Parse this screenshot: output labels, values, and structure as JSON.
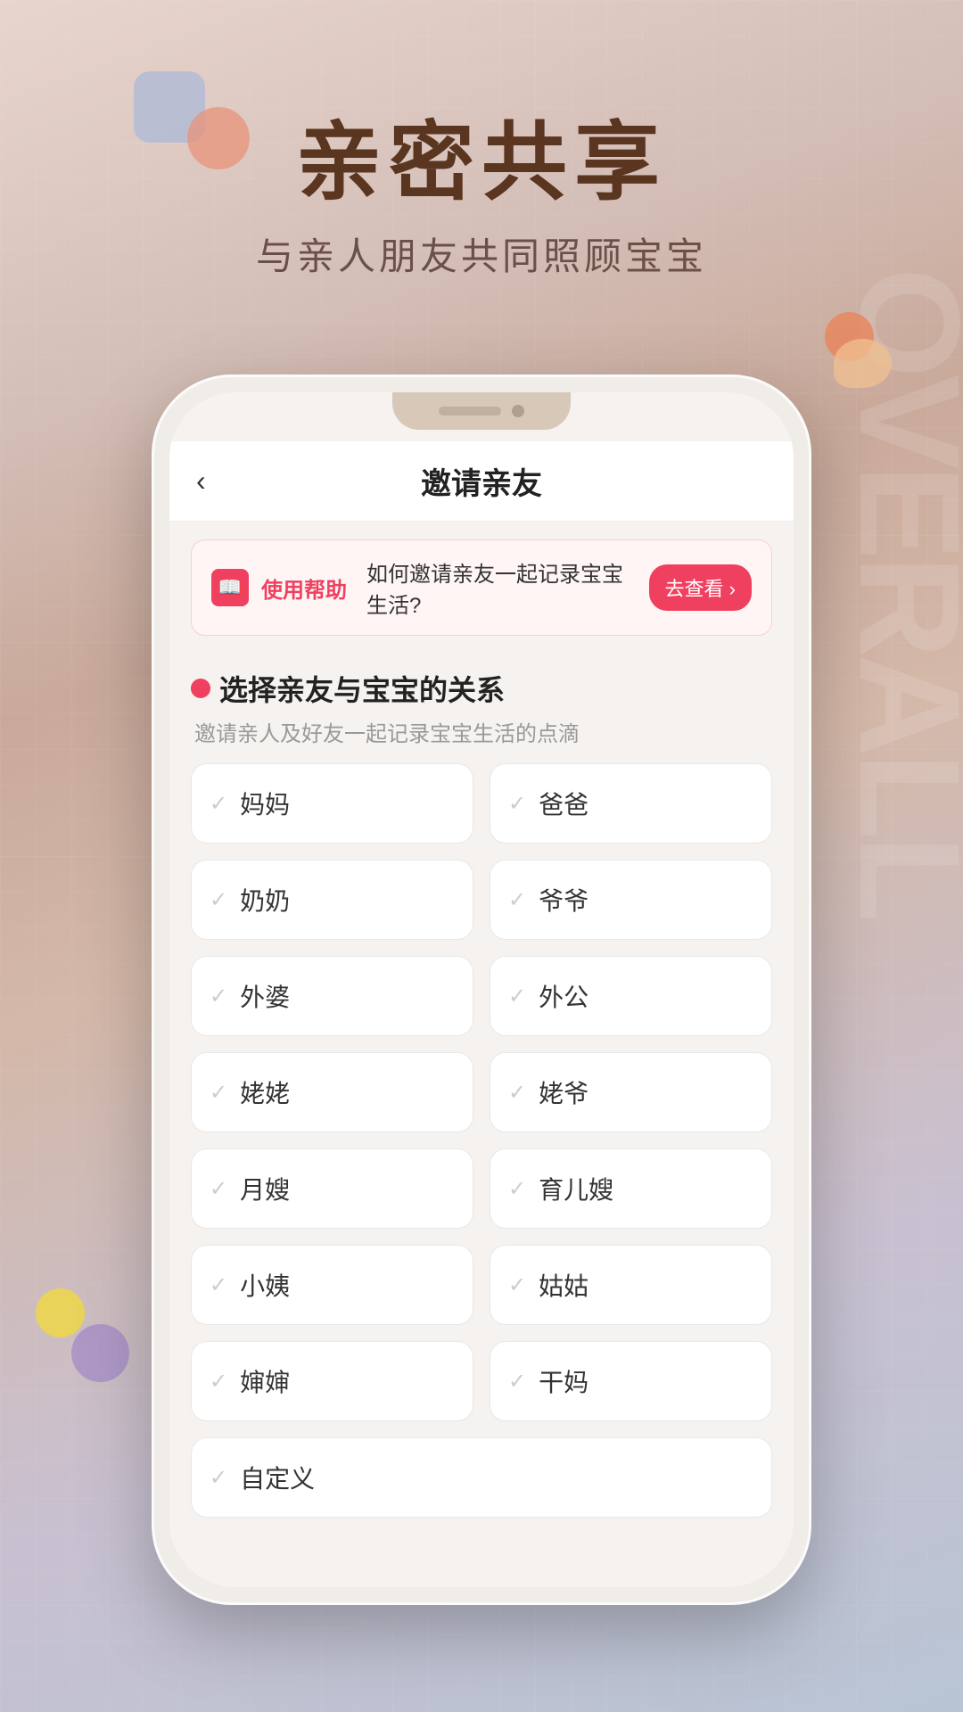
{
  "background": {
    "bgText": "OVERALL"
  },
  "header": {
    "mainTitle": "亲密共享",
    "subTitle": "与亲人朋友共同照顾宝宝"
  },
  "phone": {
    "nav": {
      "backLabel": "‹",
      "title": "邀请亲友"
    },
    "helpBanner": {
      "iconLabel": "📖",
      "label": "使用帮助",
      "text": "如何邀请亲友一起记录宝宝生活?",
      "buttonLabel": "去查看 ›"
    },
    "section": {
      "title": "选择亲友与宝宝的关系",
      "subtitle": "邀请亲人及好友一起记录宝宝生活的点滴"
    },
    "relationships": [
      {
        "name": "妈妈"
      },
      {
        "name": "爸爸"
      },
      {
        "name": "奶奶"
      },
      {
        "name": "爷爷"
      },
      {
        "name": "外婆"
      },
      {
        "name": "外公"
      },
      {
        "name": "姥姥"
      },
      {
        "name": "姥爷"
      },
      {
        "name": "月嫂"
      },
      {
        "name": "育儿嫂"
      },
      {
        "name": "小姨"
      },
      {
        "name": "姑姑"
      },
      {
        "name": "婶婶"
      },
      {
        "name": "干妈"
      }
    ],
    "customOption": {
      "name": "自定义"
    }
  },
  "colors": {
    "accent": "#f04060",
    "checkColor": "#cccccc",
    "titleColor": "#5a3520"
  }
}
